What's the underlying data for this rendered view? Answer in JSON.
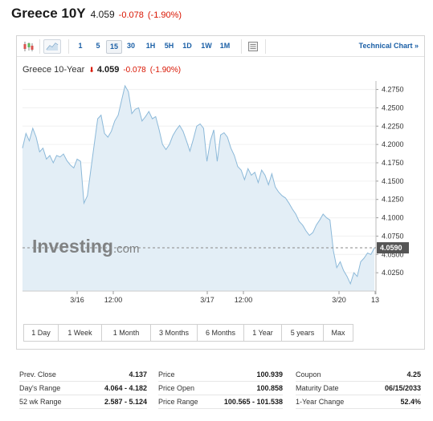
{
  "header": {
    "title": "Greece 10Y",
    "price": "4.059",
    "change": "-0.078",
    "change_pct": "(-1.90%)"
  },
  "toolbar": {
    "icons": [
      "candlestick-icon",
      "area-chart-icon",
      "settings-panel-icon"
    ],
    "timeframes": [
      "1",
      "5",
      "15",
      "30",
      "1H",
      "5H",
      "1D",
      "1W",
      "1M"
    ],
    "active_timeframe": "15",
    "technical_chart": "Technical Chart »"
  },
  "price_label": {
    "name": "Greece 10-Year",
    "arrow": "⬇",
    "price": "4.059",
    "change": "-0.078",
    "change_pct": "(-1.90%)"
  },
  "watermark": {
    "brand": "Investing",
    "suffix": ".com"
  },
  "range_buttons": [
    "1 Day",
    "1 Week",
    "1 Month",
    "3 Months",
    "6 Months",
    "1 Year",
    "5 years",
    "Max"
  ],
  "stats": {
    "col1": [
      {
        "label": "Prev. Close",
        "value": "4.137"
      },
      {
        "label": "Day's Range",
        "value": "4.064 - 4.182"
      },
      {
        "label": "52 wk Range",
        "value": "2.587 - 5.124"
      }
    ],
    "col2": [
      {
        "label": "Price",
        "value": "100.939"
      },
      {
        "label": "Price Open",
        "value": "100.858"
      },
      {
        "label": "Price Range",
        "value": "100.565 - 101.538"
      }
    ],
    "col3": [
      {
        "label": "Coupon",
        "value": "4.25"
      },
      {
        "label": "Maturity Date",
        "value": "06/15/2033"
      },
      {
        "label": "1-Year Change",
        "value": "52.4%"
      }
    ]
  },
  "colors": {
    "line": "#8cb9d9",
    "area": "#e3eef6",
    "accent_link": "#1a5fa6",
    "down": "#d91400"
  },
  "chart_data": {
    "type": "area",
    "x_tick_labels": [
      "3/16",
      "12:00",
      "3/17",
      "12:00",
      "3/20",
      "13"
    ],
    "y_tick_labels": [
      "4.2750",
      "4.2500",
      "4.2250",
      "4.2000",
      "4.1750",
      "4.1500",
      "4.1250",
      "4.1000",
      "4.0750",
      "4.0500",
      "4.0250"
    ],
    "ylim": [
      4.0,
      4.28
    ],
    "last_value_label": "4.0590",
    "last_value": 4.059,
    "series": [
      {
        "values": [
          4.195,
          4.215,
          4.205,
          4.222,
          4.21,
          4.19,
          4.195,
          4.18,
          4.185,
          4.175,
          4.185,
          4.183,
          4.187,
          4.178,
          4.172,
          4.168,
          4.18,
          4.177,
          4.12,
          4.13,
          4.165,
          4.2,
          4.235,
          4.24,
          4.215,
          4.21,
          4.218,
          4.232,
          4.24,
          4.26,
          4.28,
          4.272,
          4.242,
          4.248,
          4.25,
          4.232,
          4.238,
          4.245,
          4.235,
          4.238,
          4.22,
          4.2,
          4.193,
          4.2,
          4.212,
          4.22,
          4.226,
          4.218,
          4.205,
          4.191,
          4.207,
          4.225,
          4.228,
          4.222,
          4.177,
          4.205,
          4.22,
          4.177,
          4.213,
          4.216,
          4.21,
          4.195,
          4.185,
          4.17,
          4.165,
          4.152,
          4.167,
          4.158,
          4.162,
          4.148,
          4.165,
          4.158,
          4.145,
          4.16,
          4.142,
          4.135,
          4.13,
          4.127,
          4.12,
          4.112,
          4.105,
          4.095,
          4.09,
          4.082,
          4.076,
          4.08,
          4.09,
          4.097,
          4.105,
          4.1,
          4.097,
          4.055,
          4.032,
          4.04,
          4.028,
          4.02,
          4.01,
          4.025,
          4.02,
          4.04,
          4.045,
          4.052,
          4.05,
          4.059
        ]
      }
    ]
  }
}
